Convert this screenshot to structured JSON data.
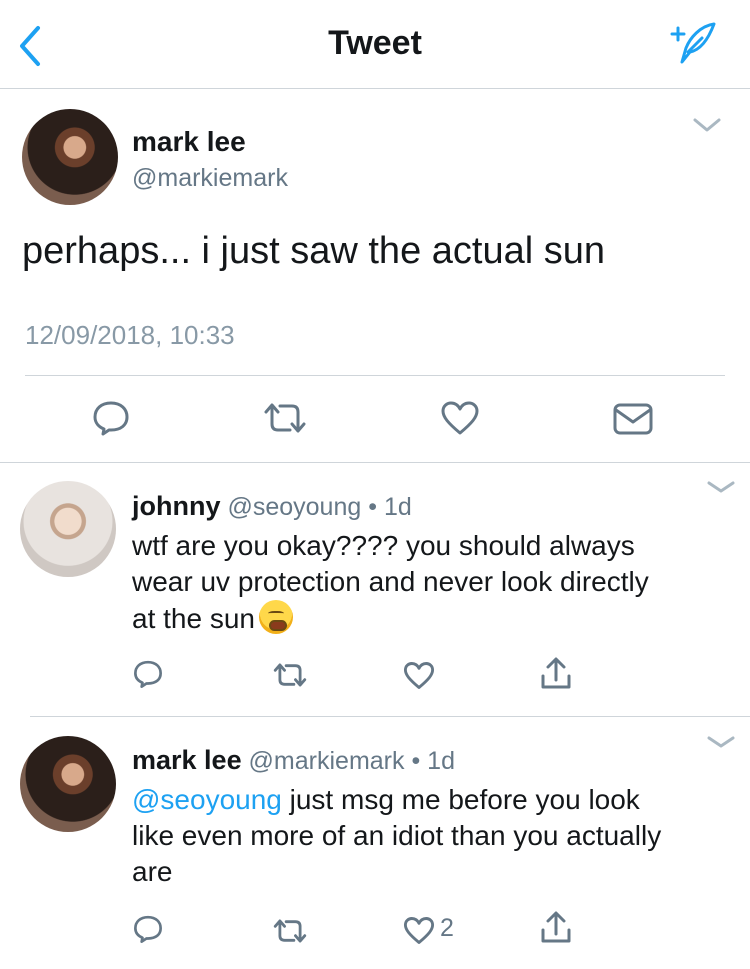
{
  "nav": {
    "title": "Tweet"
  },
  "tweet": {
    "name": "mark lee",
    "handle": "@markiemark",
    "text": "perhaps... i just saw the actual sun",
    "timestamp": "12/09/2018, 10:33"
  },
  "replies": [
    {
      "name": "johnny",
      "handle": "@seoyoung",
      "time": "1d",
      "line1": "wtf are you okay???? you should always",
      "line2": "wear uv protection and never look directly",
      "line3": "at the sun",
      "emoji": "tired-face-emoji"
    },
    {
      "name": "mark lee",
      "handle": "@markiemark",
      "time": "1d",
      "mention": "@seoyoung",
      "line1_rest": " just msg me before you look",
      "line2": "like even more of an idiot than you actually",
      "line3": "are",
      "likes": "2"
    }
  ],
  "colors": {
    "accent": "#1da1f2",
    "secondary_text": "#657786",
    "divider": "#cfd5da"
  }
}
